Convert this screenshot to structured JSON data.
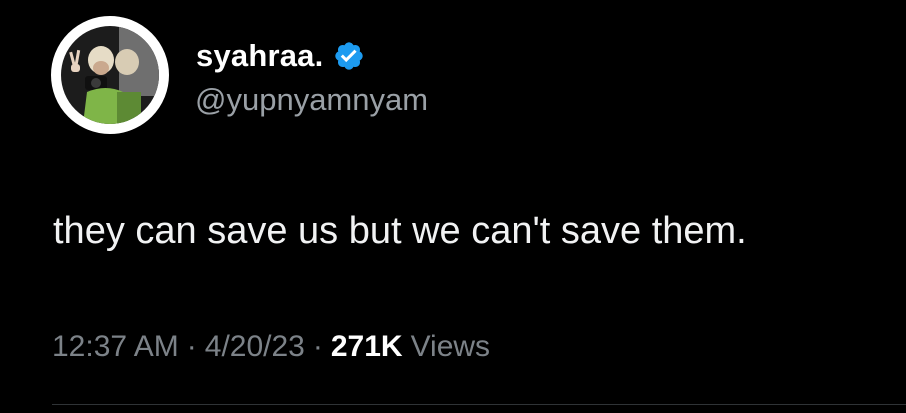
{
  "author": {
    "display_name": "syahraa.",
    "handle": "@yupnyamnyam",
    "verified": true,
    "verified_color": "#1d9bf0",
    "avatar_icon": "profile-photo"
  },
  "tweet": {
    "text": "they can save us but we can't save them.",
    "time": "12:37 AM",
    "date": "4/20/23",
    "separator": "·",
    "views_count": "271K",
    "views_label": "Views"
  },
  "colors": {
    "background": "#000000",
    "text_primary": "#e7e9ea",
    "text_secondary": "#7c8288",
    "divider": "#2f3336"
  }
}
